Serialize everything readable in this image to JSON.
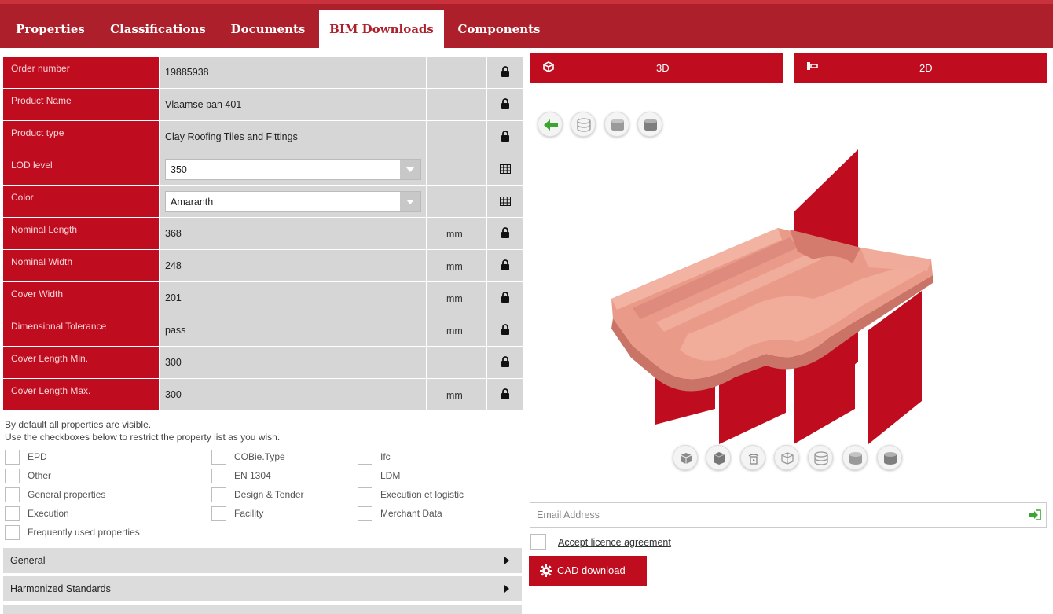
{
  "tabs": [
    {
      "label": "Properties",
      "active": false
    },
    {
      "label": "Classifications",
      "active": false
    },
    {
      "label": "Documents",
      "active": false
    },
    {
      "label": "BIM Downloads",
      "active": true
    },
    {
      "label": "Components",
      "active": false
    }
  ],
  "properties": [
    {
      "label": "Order number",
      "value": "19885938",
      "unit": "",
      "icon": "lock-icon"
    },
    {
      "label": "Product Name",
      "value": "Vlaamse pan 401",
      "unit": "",
      "icon": "lock-icon"
    },
    {
      "label": "Product type",
      "value": "Clay Roofing Tiles and Fittings",
      "unit": "",
      "icon": "lock-icon"
    },
    {
      "label": "LOD level",
      "value": "350",
      "unit": "",
      "icon": "table-icon",
      "select": true
    },
    {
      "label": "Color",
      "value": "Amaranth",
      "unit": "",
      "icon": "table-icon",
      "select": true
    },
    {
      "label": "Nominal Length",
      "value": "368",
      "unit": "mm",
      "icon": "lock-icon"
    },
    {
      "label": "Nominal Width",
      "value": "248",
      "unit": "mm",
      "icon": "lock-icon"
    },
    {
      "label": "Cover Width",
      "value": "201",
      "unit": "mm",
      "icon": "lock-icon"
    },
    {
      "label": "Dimensional Tolerance",
      "value": "pass",
      "unit": "mm",
      "icon": "lock-icon"
    },
    {
      "label": "Cover Length Min.",
      "value": "300",
      "unit": "",
      "icon": "lock-icon"
    },
    {
      "label": "Cover Length Max.",
      "value": "300",
      "unit": "mm",
      "icon": "lock-icon"
    }
  ],
  "filter_note": {
    "line1": "By default all properties are visible.",
    "line2": "Use the checkboxes below to restrict the property list as you wish."
  },
  "filters": {
    "col1": [
      "EPD",
      "Other",
      "General properties",
      "Execution",
      "Frequently used properties"
    ],
    "col2": [
      "COBie.Type",
      "EN 1304",
      "Design & Tender",
      "Facility"
    ],
    "col3": [
      "Ifc",
      "LDM",
      "Execution et logistic",
      "Merchant Data"
    ]
  },
  "sections": [
    "General",
    "Harmonized Standards"
  ],
  "viewer": {
    "btn_3d": "3D",
    "btn_2d": "2D",
    "top_icons": [
      "back-arrow-icon",
      "wireframe-icon",
      "solid-icon",
      "shaded-icon"
    ],
    "bottom_icons": [
      "perspective-icon",
      "cube-icon",
      "rotate-icon",
      "box-view-icon",
      "wireframe-icon",
      "solid-icon",
      "shaded-icon"
    ]
  },
  "download": {
    "email_placeholder": "Email Address",
    "accept_label": "Accept licence agreement",
    "cad_label": "CAD download"
  },
  "colors": {
    "brand_red": "#c00c1f",
    "tabbar_red": "#ad1f2a",
    "cell_grey": "#d6d6d6",
    "tile_salmon": "#ec9c8a"
  }
}
